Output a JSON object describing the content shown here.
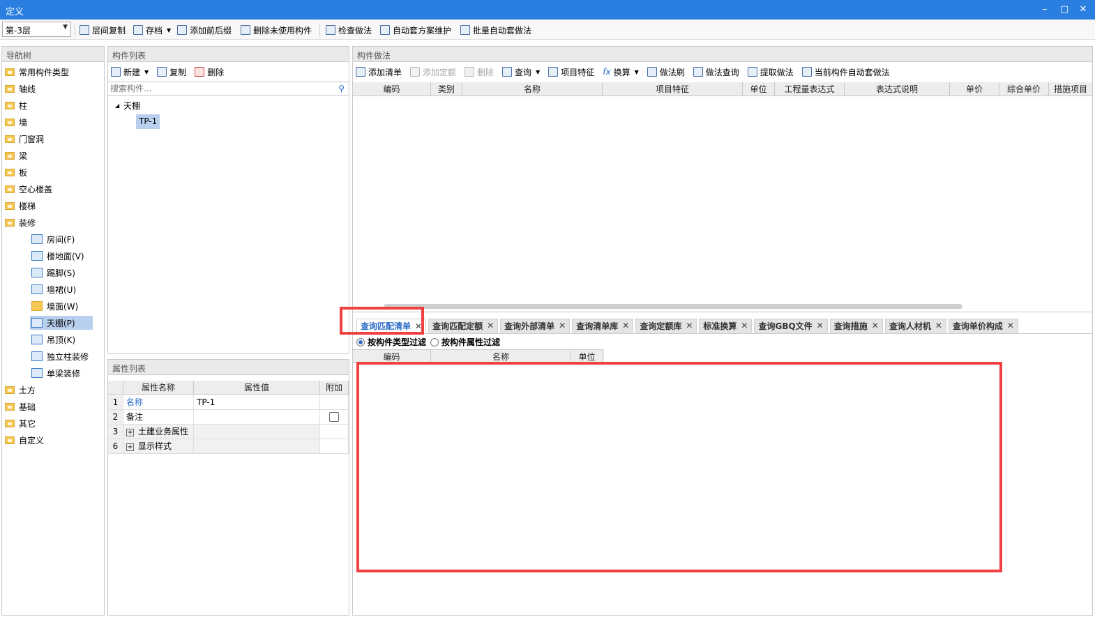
{
  "window": {
    "title": "定义"
  },
  "toolbar": {
    "floor": "第-3层",
    "buttons": [
      "层间复制",
      "存档",
      "添加前后缀",
      "删除未使用构件",
      "检查做法",
      "自动套方案维护",
      "批量自动套做法"
    ]
  },
  "nav": {
    "header": "导航树",
    "items": [
      "常用构件类型",
      "轴线",
      "柱",
      "墙",
      "门窗洞",
      "梁",
      "板",
      "空心楼盖",
      "楼梯",
      "装修"
    ],
    "sub": [
      "房间(F)",
      "楼地面(V)",
      "踢脚(S)",
      "墙裙(U)",
      "墙面(W)",
      "天棚(P)",
      "吊顶(K)",
      "独立柱装修",
      "单梁装修"
    ],
    "items2": [
      "土方",
      "基础",
      "其它",
      "自定义"
    ]
  },
  "component_list": {
    "header": "构件列表",
    "buttons": [
      "新建",
      "复制",
      "删除"
    ],
    "search_placeholder": "搜索构件...",
    "tree_root": "天棚",
    "tree_child": "TP-1"
  },
  "props": {
    "header": "属性列表",
    "cols": [
      "属性名称",
      "属性值",
      "附加"
    ],
    "rows": [
      {
        "num": "1",
        "name": "名称",
        "value": "TP-1"
      },
      {
        "num": "2",
        "name": "备注",
        "value": ""
      },
      {
        "num": "3",
        "name": "土建业务属性",
        "value": ""
      },
      {
        "num": "6",
        "name": "显示样式",
        "value": ""
      }
    ]
  },
  "method": {
    "header": "构件做法",
    "buttons": [
      "添加清单",
      "添加定额",
      "删除",
      "查询",
      "项目特征",
      "换算",
      "做法刷",
      "做法查询",
      "提取做法",
      "当前构件自动套做法"
    ],
    "cols": [
      "编码",
      "类别",
      "名称",
      "项目特征",
      "单位",
      "工程量表达式",
      "表达式说明",
      "单价",
      "综合单价",
      "措施项目"
    ]
  },
  "query": {
    "tabs": [
      "查询匹配清单",
      "查询匹配定额",
      "查询外部清单",
      "查询清单库",
      "查询定额库",
      "标准换算",
      "查询GBQ文件",
      "查询措施",
      "查询人材机",
      "查询单价构成"
    ],
    "filter1": "按构件类型过滤",
    "filter2": "按构件属性过滤",
    "cols": [
      "编码",
      "名称",
      "单位"
    ]
  },
  "icons": {
    "folder": "folder-icon",
    "search": "search-icon",
    "close": "close-icon"
  },
  "colors": {
    "titlebar": "#2b7fe0",
    "highlight": "#f04040",
    "selected": "#b9cfee"
  }
}
